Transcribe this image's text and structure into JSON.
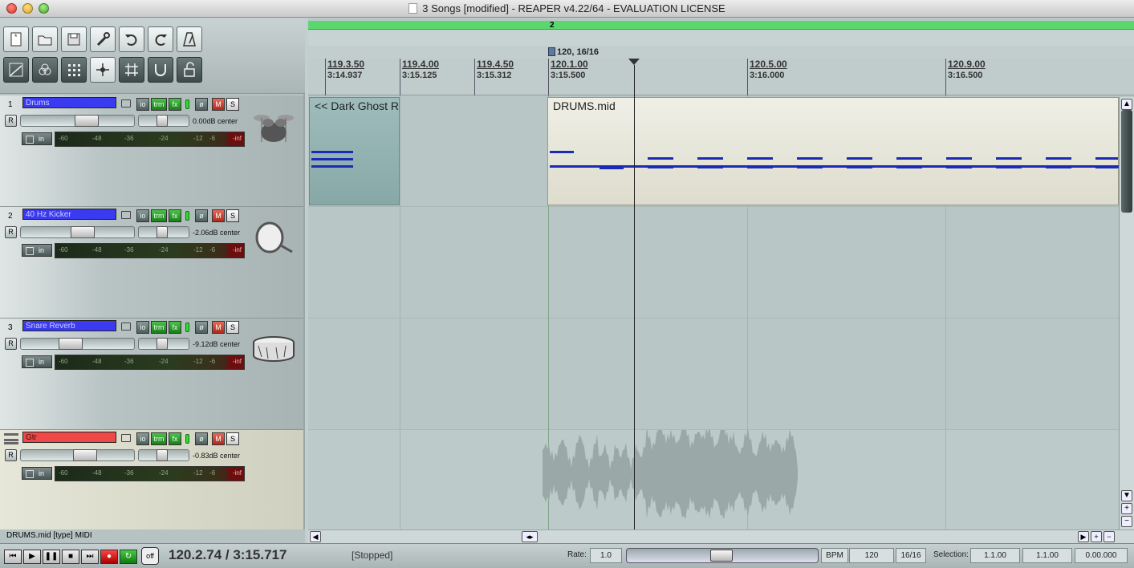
{
  "window": {
    "title": "3 Songs [modified] - REAPER v4.22/64 - EVALUATION LICENSE"
  },
  "toolbar": {
    "row1": [
      "new-project-icon",
      "open-project-icon",
      "save-project-icon",
      "preferences-wrench-icon",
      "undo-icon",
      "redo-icon",
      "metronome-icon"
    ],
    "row2": [
      "envelope-icon",
      "ripple-editing-icon",
      "grid-snap-icon",
      "item-grouping-icon",
      "snap-grid-icon",
      "auto-crossfade-icon",
      "lock-icon"
    ]
  },
  "tracks": [
    {
      "num": "1",
      "name": "Drums",
      "volume": "0.00dB center",
      "icon": "drum-kit-icon",
      "color": "#3a3af0"
    },
    {
      "num": "2",
      "name": "40 Hz Kicker",
      "volume": "-2.06dB center",
      "icon": "bass-drum-icon",
      "color": "#3a3af0"
    },
    {
      "num": "3",
      "name": "Snare Reverb",
      "volume": "-9.12dB center",
      "icon": "snare-drum-icon",
      "color": "#3a3af0"
    },
    {
      "num": "",
      "name": "Gtr",
      "volume": "-0.83dB center",
      "icon": "",
      "color": "#f04848"
    }
  ],
  "track_buttons": {
    "io": "io",
    "trim": "trm",
    "fx": "fx",
    "phase": "ø",
    "mute": "M",
    "solo": "S",
    "rec_arm": "R",
    "monitor_in": "in"
  },
  "meter_ticks": [
    "-60",
    "-48",
    "-36",
    "-24",
    "-12",
    "-6"
  ],
  "meter_peak": "-inf",
  "ruler": {
    "region_marker": "2",
    "tempo_marker": "120, 16/16",
    "ticks": [
      {
        "bar": "119.3.50",
        "time": "3:14.937"
      },
      {
        "bar": "119.4.00",
        "time": "3:15.125"
      },
      {
        "bar": "119.4.50",
        "time": "3:15.312"
      },
      {
        "bar": "120.1.00",
        "time": "3:15.500"
      },
      {
        "bar": "120.5.00",
        "time": "3:16.000"
      },
      {
        "bar": "120.9.00",
        "time": "3:16.500"
      }
    ]
  },
  "items": {
    "ghost": "<< Dark Ghost R",
    "drums": "DRUMS.mid"
  },
  "status": {
    "item_info": "DRUMS.mid [type] MIDI"
  },
  "transport": {
    "buttons": [
      "skip-to-start-icon",
      "play-icon",
      "pause-icon",
      "stop-icon",
      "skip-to-end-icon",
      "record-icon",
      "loop-icon"
    ],
    "off_label": "off",
    "position": "120.2.74 / 3:15.717",
    "state": "[Stopped]",
    "rate_label": "Rate:",
    "rate": "1.0",
    "bpm_label": "BPM",
    "bpm": "120",
    "timesig": "16/16",
    "selection_label": "Selection:",
    "sel_start": "1.1.00",
    "sel_end": "1.1.00",
    "sel_len": "0.00.000"
  }
}
